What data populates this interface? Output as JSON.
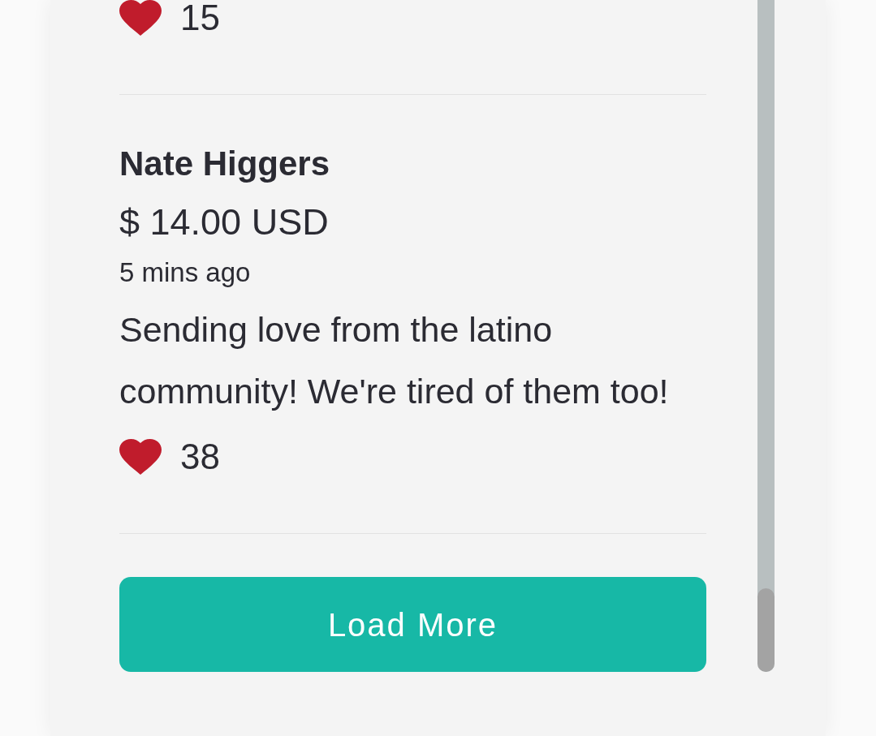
{
  "donations": [
    {
      "likes": "15"
    },
    {
      "name": "Nate Higgers",
      "amount": "$ 14.00 USD",
      "time": "5 mins ago",
      "message": "Sending love from the latino community! We're tired of them too!",
      "likes": "38"
    }
  ],
  "load_more_button": {
    "label": "Load More"
  }
}
